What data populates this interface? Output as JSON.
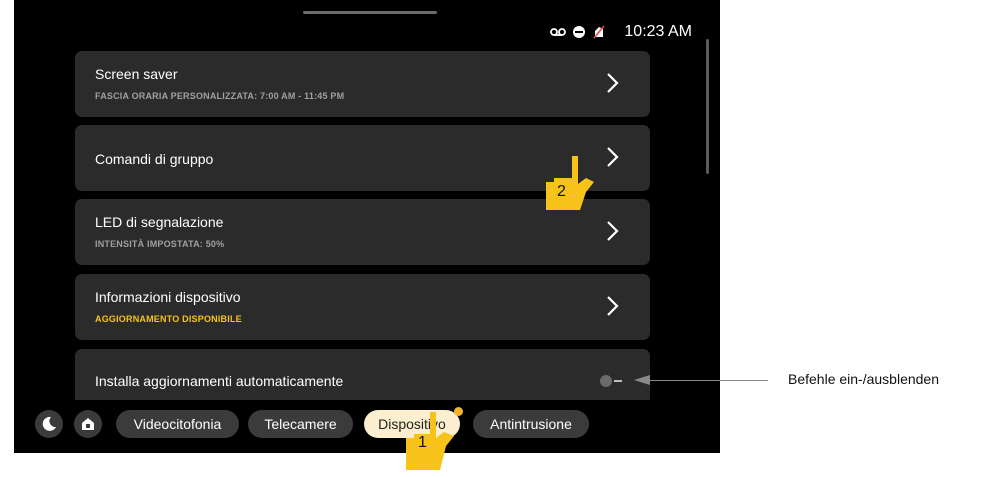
{
  "status_bar": {
    "time": "10:23 AM",
    "icons": [
      "voicemail-icon",
      "do-not-disturb-icon",
      "mute-icon"
    ]
  },
  "settings_list": [
    {
      "title": "Screen saver",
      "subtitle": "FASCIA ORARIA PERSONALIZZATA: 7:00 AM - 11:45 PM",
      "control": "chevron"
    },
    {
      "title": "Comandi di gruppo",
      "subtitle": "",
      "control": "chevron"
    },
    {
      "title": "LED di segnalazione",
      "subtitle": "INTENSITÀ IMPOSTATA: 50%",
      "control": "chevron"
    },
    {
      "title": "Informazioni dispositivo",
      "subtitle": "AGGIORNAMENTO DISPONIBILE",
      "subtitle_color": "#f7c31a",
      "control": "chevron"
    },
    {
      "title": "Installa aggiornamenti automaticamente",
      "subtitle": "",
      "control": "toggle",
      "toggle_on": false
    }
  ],
  "bottom_nav": {
    "icons": [
      "night-mode-icon",
      "home-scenario-icon"
    ],
    "tabs": [
      "Videocitofonia",
      "Telecamere",
      "Dispositivo",
      "Antintrusione"
    ],
    "active_tab": "Dispositivo"
  },
  "annotations": {
    "hand1_number": "1",
    "hand2_number": "2",
    "callout_text": "Befehle ein-/ausblenden"
  },
  "colors": {
    "accent": "#f7c31a",
    "card_bg": "#2b2b2b",
    "active_tab_bg": "#fcefcf",
    "notification_dot": "#f2b42a"
  }
}
